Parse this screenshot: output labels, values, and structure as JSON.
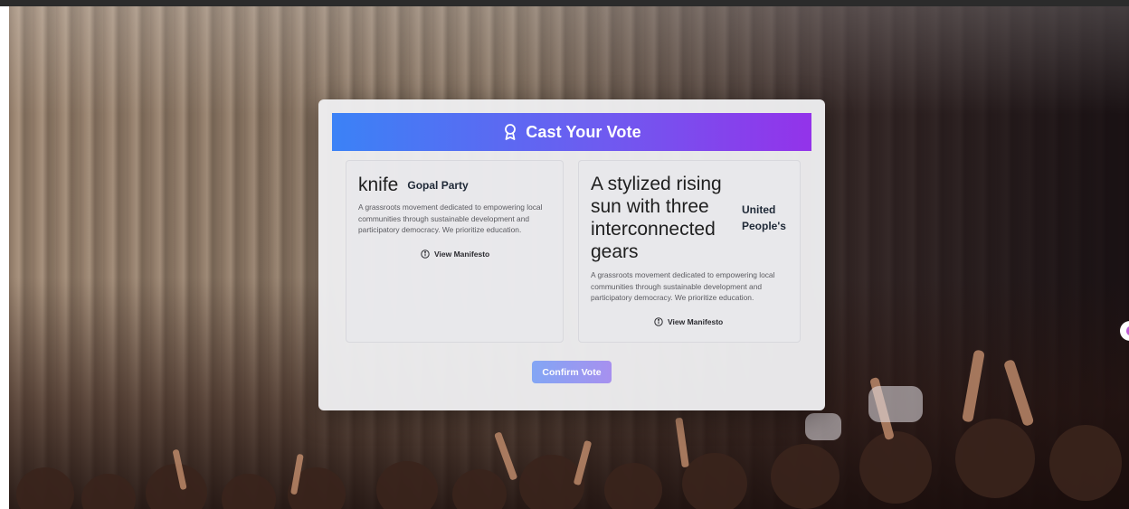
{
  "header": {
    "title": "Cast Your Vote",
    "icon": "award-ribbon-icon"
  },
  "candidates": [
    {
      "symbol": "knife",
      "party_name": "Gopal Party",
      "description": "A grassroots movement dedicated to empowering local communities through sustainable development and participatory democracy. We prioritize education.",
      "manifesto_label": "View Manifesto"
    },
    {
      "symbol": "A stylized rising sun with three interconnected gears",
      "party_name": "United People's",
      "description": "A grassroots movement dedicated to empowering local communities through sustainable development and participatory democracy. We prioritize education.",
      "manifesto_label": "View Manifesto"
    }
  ],
  "confirm_label": "Confirm Vote",
  "colors": {
    "header_start": "#3b82f6",
    "header_end": "#9333ea",
    "confirm_button": "#8e98f3"
  }
}
